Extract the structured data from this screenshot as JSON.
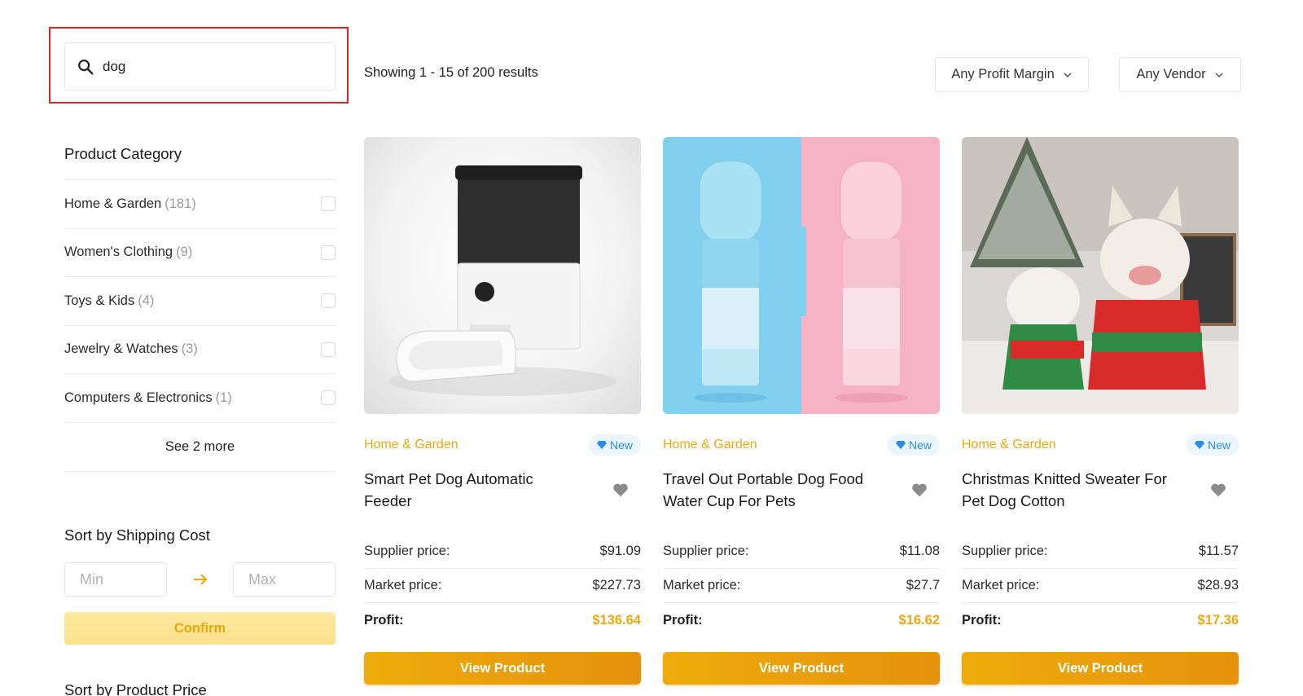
{
  "search": {
    "value": "dog",
    "icon": "search-icon"
  },
  "results": {
    "text": "Showing 1 - 15 of 200 results"
  },
  "filters": {
    "profit_margin": "Any Profit Margin",
    "vendor": "Any Vendor"
  },
  "sidebar": {
    "category_title": "Product Category",
    "categories": [
      {
        "name": "Home & Garden",
        "count": "(181)"
      },
      {
        "name": "Women's Clothing",
        "count": "(9)"
      },
      {
        "name": "Toys & Kids",
        "count": "(4)"
      },
      {
        "name": "Jewelry & Watches",
        "count": "(3)"
      },
      {
        "name": "Computers & Electronics",
        "count": "(1)"
      }
    ],
    "see_more": "See 2 more",
    "shipping_title": "Sort by Shipping Cost",
    "min_placeholder": "Min",
    "max_placeholder": "Max",
    "confirm": "Confirm",
    "price_title": "Sort by Product Price"
  },
  "labels": {
    "supplier": "Supplier price:",
    "market": "Market price:",
    "profit": "Profit:",
    "view": "View Product",
    "badge": "New"
  },
  "products": [
    {
      "category": "Home & Garden",
      "title": "Smart Pet Dog Automatic Feeder",
      "supplier_price": "$91.09",
      "market_price": "$227.73",
      "profit": "$136.64"
    },
    {
      "category": "Home & Garden",
      "title": "Travel Out Portable Dog Food Water Cup For Pets",
      "supplier_price": "$11.08",
      "market_price": "$27.7",
      "profit": "$16.62"
    },
    {
      "category": "Home & Garden",
      "title": "Christmas Knitted Sweater For Pet Dog Cotton",
      "supplier_price": "$11.57",
      "market_price": "$28.93",
      "profit": "$17.36"
    }
  ],
  "colors": {
    "accent": "#eba90f",
    "badge_blue": "#2b8ee6",
    "highlight_red": "#e0241f"
  }
}
